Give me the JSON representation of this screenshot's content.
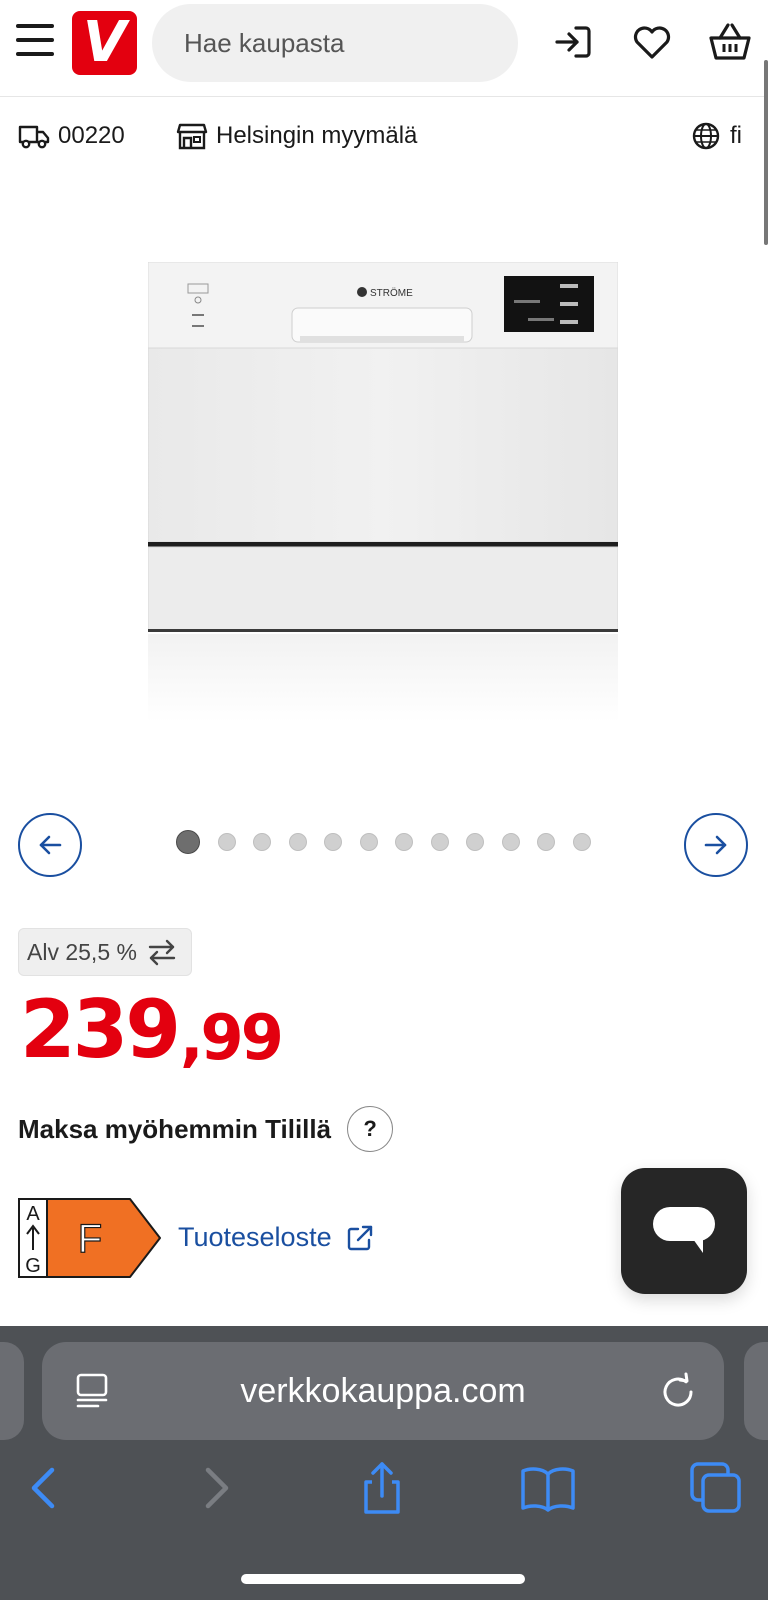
{
  "header": {
    "logo_text": "V",
    "search_placeholder": "Hae kaupasta",
    "icons": [
      "menu-icon",
      "search-icon",
      "login-icon",
      "heart-icon",
      "basket-icon"
    ]
  },
  "subbar": {
    "postal_code": "00220",
    "store": "Helsingin myymälä",
    "language": "fi"
  },
  "product": {
    "brand_on_image": "STRÖME"
  },
  "carousel": {
    "dots_total": 12,
    "active_index": 0
  },
  "vat": {
    "label": "Alv 25,5 %"
  },
  "price": {
    "integer": "239",
    "decimal": ",99",
    "color": "#e3000f"
  },
  "paylater": {
    "label": "Maksa myöhemmin Tilillä",
    "help": "?"
  },
  "energy": {
    "class": "F",
    "scale_top": "A",
    "scale_bottom": "G",
    "color": "#f07023",
    "datasheet_label": "Tuoteseloste"
  },
  "browser": {
    "url": "verkkokauppa.com",
    "accent": "#3d8bf5"
  }
}
